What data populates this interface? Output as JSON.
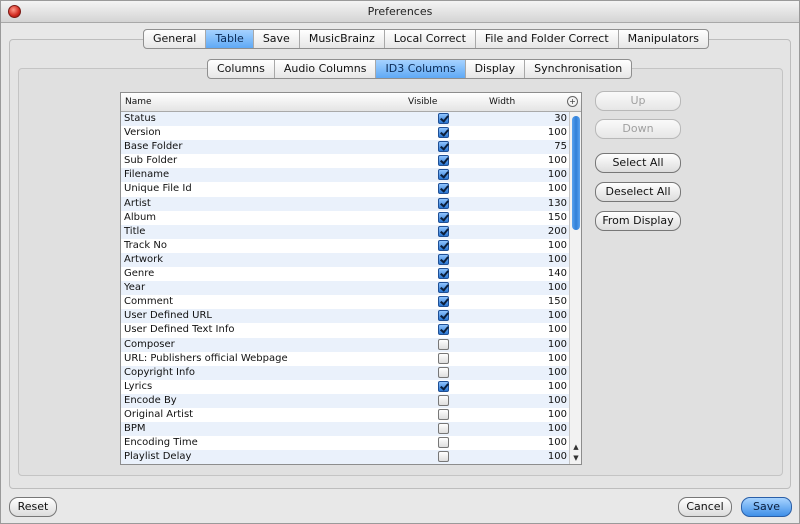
{
  "window": {
    "title": "Preferences"
  },
  "top_tabs": [
    {
      "label": "General",
      "active": false
    },
    {
      "label": "Table",
      "active": true
    },
    {
      "label": "Save",
      "active": false
    },
    {
      "label": "MusicBrainz",
      "active": false
    },
    {
      "label": "Local Correct",
      "active": false
    },
    {
      "label": "File and Folder Correct",
      "active": false
    },
    {
      "label": "Manipulators",
      "active": false
    }
  ],
  "sub_tabs": [
    {
      "label": "Columns",
      "active": false
    },
    {
      "label": "Audio Columns",
      "active": false
    },
    {
      "label": "ID3 Columns",
      "active": true
    },
    {
      "label": "Display",
      "active": false
    },
    {
      "label": "Synchronisation",
      "active": false
    }
  ],
  "table": {
    "headers": {
      "name": "Name",
      "visible": "Visible",
      "width": "Width"
    },
    "rows": [
      {
        "name": "Status",
        "visible": true,
        "width": "30"
      },
      {
        "name": "Version",
        "visible": true,
        "width": "100"
      },
      {
        "name": "Base Folder",
        "visible": true,
        "width": "75"
      },
      {
        "name": "Sub Folder",
        "visible": true,
        "width": "100"
      },
      {
        "name": "Filename",
        "visible": true,
        "width": "100"
      },
      {
        "name": "Unique File Id",
        "visible": true,
        "width": "100"
      },
      {
        "name": "Artist",
        "visible": true,
        "width": "130"
      },
      {
        "name": "Album",
        "visible": true,
        "width": "150"
      },
      {
        "name": "Title",
        "visible": true,
        "width": "200"
      },
      {
        "name": "Track No",
        "visible": true,
        "width": "100"
      },
      {
        "name": "Artwork",
        "visible": true,
        "width": "100"
      },
      {
        "name": "Genre",
        "visible": true,
        "width": "140"
      },
      {
        "name": "Year",
        "visible": true,
        "width": "100"
      },
      {
        "name": "Comment",
        "visible": true,
        "width": "150"
      },
      {
        "name": "User Defined URL",
        "visible": true,
        "width": "100"
      },
      {
        "name": "User Defined Text Info",
        "visible": true,
        "width": "100"
      },
      {
        "name": "Composer",
        "visible": false,
        "width": "100"
      },
      {
        "name": "URL: Publishers official Webpage",
        "visible": false,
        "width": "100"
      },
      {
        "name": "Copyright Info",
        "visible": false,
        "width": "100"
      },
      {
        "name": "Lyrics",
        "visible": true,
        "width": "100"
      },
      {
        "name": "Encode By",
        "visible": false,
        "width": "100"
      },
      {
        "name": "Original Artist",
        "visible": false,
        "width": "100"
      },
      {
        "name": "BPM",
        "visible": false,
        "width": "100"
      },
      {
        "name": "Encoding Time",
        "visible": false,
        "width": "100"
      },
      {
        "name": "Playlist Delay",
        "visible": false,
        "width": "100"
      }
    ]
  },
  "side_buttons": {
    "up": "Up",
    "down": "Down",
    "select_all": "Select All",
    "deselect_all": "Deselect All",
    "from_display": "From Display"
  },
  "bottom_buttons": {
    "reset": "Reset",
    "cancel": "Cancel",
    "save": "Save"
  },
  "icons": {
    "close": "close-icon",
    "column-toggle": "column-settings-icon",
    "scroll-up": "arrow-up-icon",
    "scroll-down": "arrow-down-icon"
  },
  "colors": {
    "accent": "#5fa9f5",
    "close": "#d0281e"
  }
}
